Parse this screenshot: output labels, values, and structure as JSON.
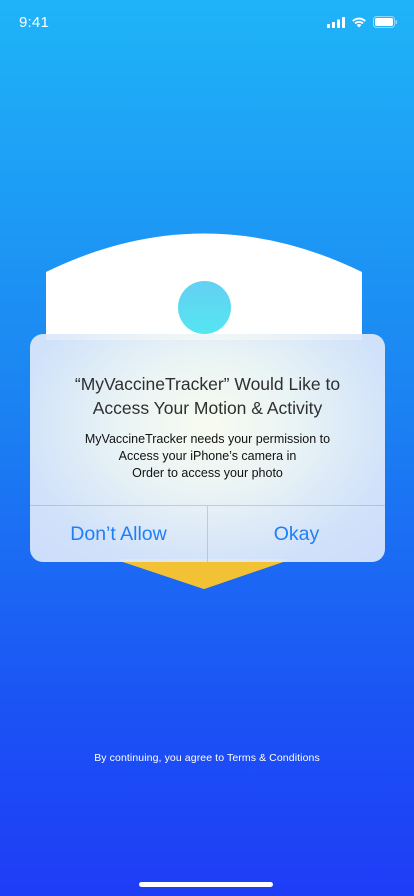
{
  "status_bar": {
    "time": "9:41"
  },
  "alert": {
    "title_line1": "“MyVaccineTracker” Would Like to",
    "title_line2": "Access Your Motion & Activity",
    "message_line1": "MyVaccineTracker needs your permission to",
    "message_line2": "Access your iPhone’s camera in",
    "message_line3": "Order to access your photo",
    "deny_label": "Don’t Allow",
    "allow_label": "Okay"
  },
  "footer": {
    "terms_text": "By continuing, you agree to Terms & Conditions"
  },
  "colors": {
    "accent": "#1f7ff5",
    "shield_white": "#ffffff",
    "shield_gold": "#f3c234",
    "avatar_start": "#64d0f3",
    "avatar_end": "#55e5f1"
  }
}
